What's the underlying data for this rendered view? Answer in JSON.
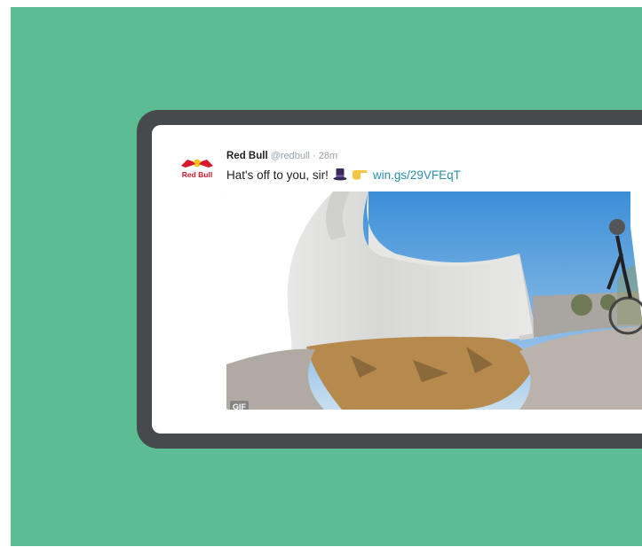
{
  "tweet": {
    "author_name": "Red Bull",
    "handle": "@redbull",
    "separator": "·",
    "time": "28m",
    "text": "Hat's off to you, sir!",
    "link": "win.gs/29VFEqT",
    "emojis": [
      "top-hat-icon",
      "pointing-hand-icon"
    ],
    "media_badge": "GIF"
  },
  "brand": {
    "logo_text": "Red Bull",
    "colors": {
      "background": "#5cbd94",
      "frame": "#464a4d",
      "link": "#2a8fa8",
      "logo_red": "#d8192d",
      "logo_yellow": "#f7c21b"
    }
  }
}
